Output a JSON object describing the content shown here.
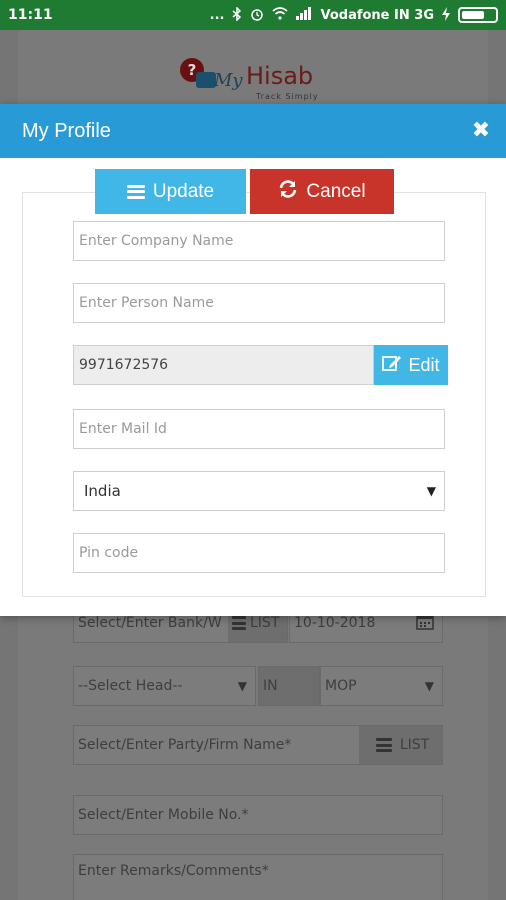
{
  "status_bar": {
    "time": "11:11",
    "dots": "...",
    "carrier": "Vodafone IN 3G",
    "icons": [
      "bluetooth-icon",
      "alarm-icon",
      "wifi-icon",
      "signal-icon",
      "charging-icon",
      "battery-icon"
    ]
  },
  "logo": {
    "q": "?",
    "my": "My",
    "hisab": "Hisab",
    "tagline": "Track Simply"
  },
  "background_form": {
    "bank_placeholder": "Select/Enter Bank/W",
    "list_label": "LIST",
    "date_value": "10-10-2018",
    "head_select": "--Select Head--",
    "in_label": "IN",
    "mop_select": "MOP",
    "party_placeholder": "Select/Enter Party/Firm Name*",
    "party_list_label": "LIST",
    "mobile_placeholder": "Select/Enter Mobile No.*",
    "remarks_placeholder": "Enter Remarks/Comments*"
  },
  "modal": {
    "title": "My Profile",
    "close_symbol": "✖",
    "update_label": "Update",
    "cancel_label": "Cancel",
    "company_placeholder": "Enter Company Name",
    "person_placeholder": "Enter Person Name",
    "phone_value": "9971672576",
    "edit_label": "Edit",
    "mail_placeholder": "Enter Mail Id",
    "country_selected": "India",
    "pincode_placeholder": "Pin code"
  },
  "colors": {
    "status_bar": "#1f7a32",
    "header": "#289ad6",
    "update_button": "#41b7e8",
    "cancel_button": "#c8342a"
  }
}
